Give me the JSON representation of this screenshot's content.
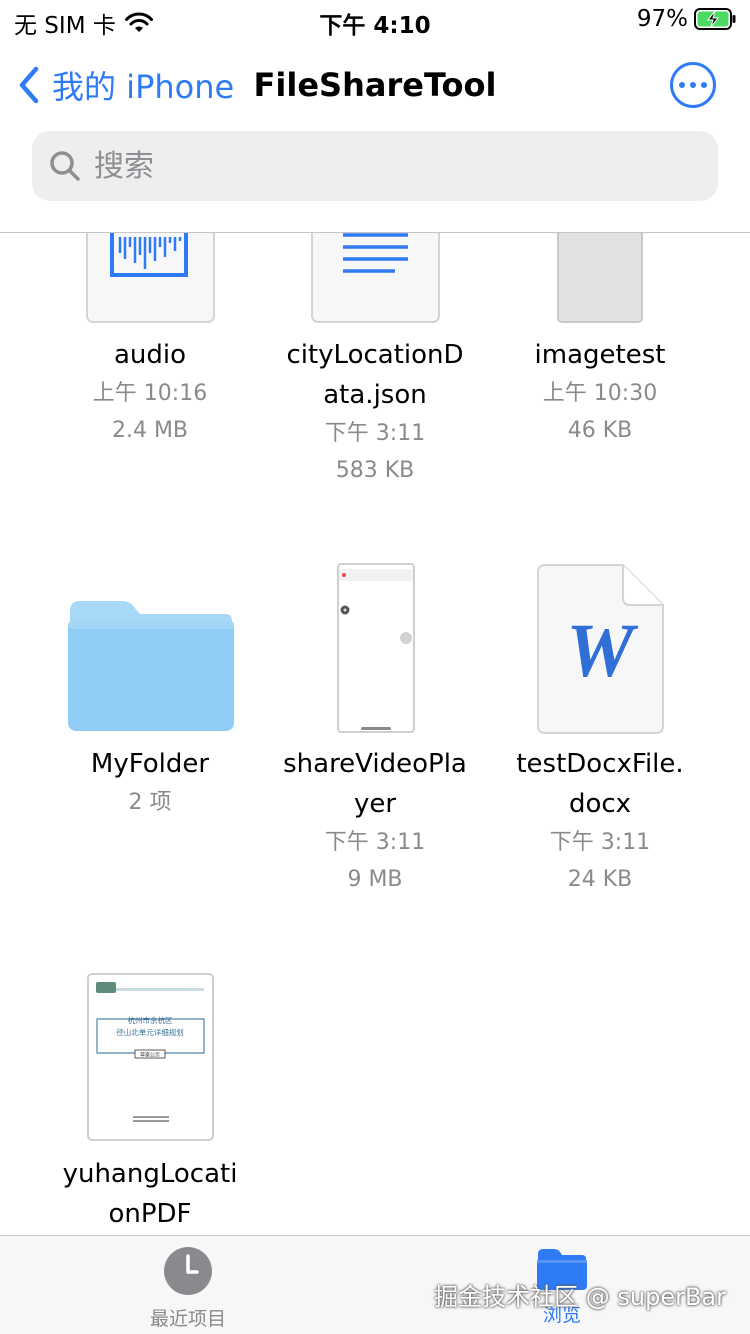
{
  "status": {
    "carrier": "无 SIM 卡",
    "time": "下午 4:10",
    "battery": "97%"
  },
  "nav": {
    "back_label": "我的 iPhone",
    "title": "FileShareTool"
  },
  "search": {
    "placeholder": "搜索"
  },
  "files": [
    {
      "name_lines": [
        "audio"
      ],
      "date": "上午 10:16",
      "size": "2.4 MB"
    },
    {
      "name_lines": [
        "cityLocationD",
        "ata.json"
      ],
      "date": "下午 3:11",
      "size": "583 KB"
    },
    {
      "name_lines": [
        "imagetest"
      ],
      "date": "上午 10:30",
      "size": "46 KB"
    },
    {
      "name_lines": [
        "MyFolder"
      ],
      "count": "2 项"
    },
    {
      "name_lines": [
        "shareVideoPla",
        "yer"
      ],
      "date": "下午 3:11",
      "size": "9 MB"
    },
    {
      "name_lines": [
        "testDocxFile.",
        "docx"
      ],
      "date": "下午 3:11",
      "size": "24 KB"
    },
    {
      "name_lines": [
        "yuhangLocati",
        "onPDF"
      ]
    }
  ],
  "pdf_thumb": {
    "line1": "杭州市余杭区",
    "line2": "径山北单元详细规划",
    "tag": "草案公示"
  },
  "docx_glyph": "W",
  "tabs": {
    "recent": "最近项目",
    "browse": "浏览"
  },
  "watermark": "掘金技术社区 @ superBar",
  "colors": {
    "accent": "#2f7bf6",
    "folder": "#90cdf4",
    "secondary_text": "#8a8a8e"
  }
}
